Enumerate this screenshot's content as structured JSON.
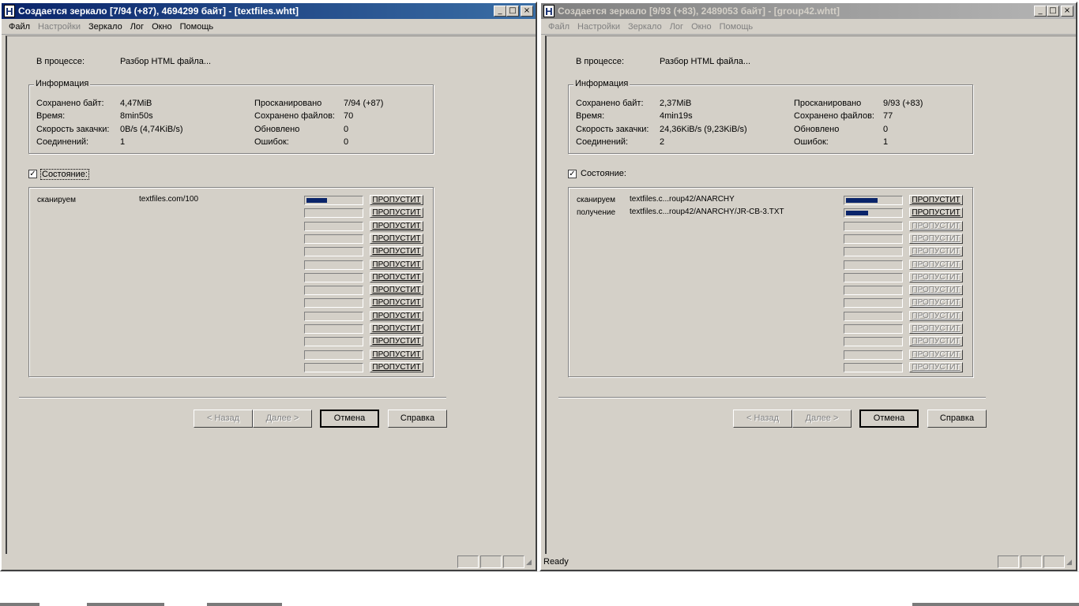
{
  "windows": [
    {
      "id": "A",
      "title": "Создается зеркало [7/94 (+87), 4694299 байт] - [textfiles.whtt]",
      "active": true,
      "title_buttons": {
        "minimize": "_",
        "maximize": "□",
        "close": "×"
      },
      "menu": [
        "Файл",
        "Настройки",
        "Зеркало",
        "Лог",
        "Окно",
        "Помощь"
      ],
      "menu_disabled": [
        1
      ],
      "progress_label": "В процессе:",
      "progress_value": "Разбор HTML файла...",
      "info": {
        "title": "Информация",
        "saved_bytes_label": "Сохранено байт:",
        "saved_bytes": "4,47MiB",
        "time_label": "Время:",
        "time": "8min50s",
        "speed_label": "Скорость закачки:",
        "speed": "0B/s (4,74KiB/s)",
        "connections_label": "Соединений:",
        "connections": "1",
        "scanned_label": "Просканировано",
        "scanned": "7/94 (+87)",
        "files_saved_label": "Сохранено файлов:",
        "files_saved": "70",
        "updated_label": "Обновлено",
        "updated": "0",
        "errors_label": "Ошибок:",
        "errors": "0"
      },
      "status_checkbox": {
        "label": "Состояние:",
        "checked": true,
        "mark": "✓"
      },
      "rows": [
        {
          "action": "сканируем",
          "url": "textfiles.com/100",
          "progress": 0.38,
          "skip_enabled": true
        },
        {
          "action": "",
          "url": "",
          "progress": 0,
          "skip_enabled": true
        },
        {
          "action": "",
          "url": "",
          "progress": 0,
          "skip_enabled": true
        },
        {
          "action": "",
          "url": "",
          "progress": 0,
          "skip_enabled": true
        },
        {
          "action": "",
          "url": "",
          "progress": 0,
          "skip_enabled": true
        },
        {
          "action": "",
          "url": "",
          "progress": 0,
          "skip_enabled": true
        },
        {
          "action": "",
          "url": "",
          "progress": 0,
          "skip_enabled": true
        },
        {
          "action": "",
          "url": "",
          "progress": 0,
          "skip_enabled": true
        },
        {
          "action": "",
          "url": "",
          "progress": 0,
          "skip_enabled": true
        },
        {
          "action": "",
          "url": "",
          "progress": 0,
          "skip_enabled": true
        },
        {
          "action": "",
          "url": "",
          "progress": 0,
          "skip_enabled": true
        },
        {
          "action": "",
          "url": "",
          "progress": 0,
          "skip_enabled": true
        },
        {
          "action": "",
          "url": "",
          "progress": 0,
          "skip_enabled": true
        },
        {
          "action": "",
          "url": "",
          "progress": 0,
          "skip_enabled": true
        }
      ],
      "skip_label": "ПРОПУСТИТ",
      "buttons": {
        "back": "< Назад",
        "next": "Далее >",
        "cancel": "Отмена",
        "help": "Справка"
      },
      "status_text": ""
    },
    {
      "id": "B",
      "title": "Создается зеркало [9/93 (+83), 2489053 байт] - [group42.whtt]",
      "active": false,
      "title_buttons": {
        "minimize": "_",
        "maximize": "□",
        "close": "×"
      },
      "menu": [
        "Файл",
        "Настройки",
        "Зеркало",
        "Лог",
        "Окно",
        "Помощь"
      ],
      "menu_disabled": [
        0,
        1,
        2,
        3,
        4,
        5
      ],
      "progress_label": "В процессе:",
      "progress_value": "Разбор HTML файла...",
      "info": {
        "title": "Информация",
        "saved_bytes_label": "Сохранено байт:",
        "saved_bytes": "2,37MiB",
        "time_label": "Время:",
        "time": "4min19s",
        "speed_label": "Скорость закачки:",
        "speed": "24,36KiB/s (9,23KiB/s)",
        "connections_label": "Соединений:",
        "connections": "2",
        "scanned_label": "Просканировано",
        "scanned": "9/93 (+83)",
        "files_saved_label": "Сохранено файлов:",
        "files_saved": "77",
        "updated_label": "Обновлено",
        "updated": "0",
        "errors_label": "Ошибок:",
        "errors": "1"
      },
      "status_checkbox": {
        "label": "Состояние:",
        "checked": true,
        "mark": "✓"
      },
      "rows": [
        {
          "action": "сканируем",
          "url": "textfiles.c...roup42/ANARCHY",
          "progress": 0.58,
          "skip_enabled": true
        },
        {
          "action": "получение",
          "url": "textfiles.c...roup42/ANARCHY/JR-CB-3.TXT",
          "progress": 0.4,
          "skip_enabled": true
        },
        {
          "action": "",
          "url": "",
          "progress": 0,
          "skip_enabled": false
        },
        {
          "action": "",
          "url": "",
          "progress": 0,
          "skip_enabled": false
        },
        {
          "action": "",
          "url": "",
          "progress": 0,
          "skip_enabled": false
        },
        {
          "action": "",
          "url": "",
          "progress": 0,
          "skip_enabled": false
        },
        {
          "action": "",
          "url": "",
          "progress": 0,
          "skip_enabled": false
        },
        {
          "action": "",
          "url": "",
          "progress": 0,
          "skip_enabled": false
        },
        {
          "action": "",
          "url": "",
          "progress": 0,
          "skip_enabled": false
        },
        {
          "action": "",
          "url": "",
          "progress": 0,
          "skip_enabled": false
        },
        {
          "action": "",
          "url": "",
          "progress": 0,
          "skip_enabled": false
        },
        {
          "action": "",
          "url": "",
          "progress": 0,
          "skip_enabled": false
        },
        {
          "action": "",
          "url": "",
          "progress": 0,
          "skip_enabled": false
        },
        {
          "action": "",
          "url": "",
          "progress": 0,
          "skip_enabled": false
        }
      ],
      "skip_label": "ПРОПУСТИТ",
      "buttons": {
        "back": "< Назад",
        "next": "Далее >",
        "cancel": "Отмена",
        "help": "Справка"
      },
      "status_text": "Ready"
    }
  ],
  "colors": {
    "progress_fill": "#0a246a",
    "title_active": "#0a246a",
    "title_inactive": "#808080",
    "face": "#d4d0c8"
  }
}
